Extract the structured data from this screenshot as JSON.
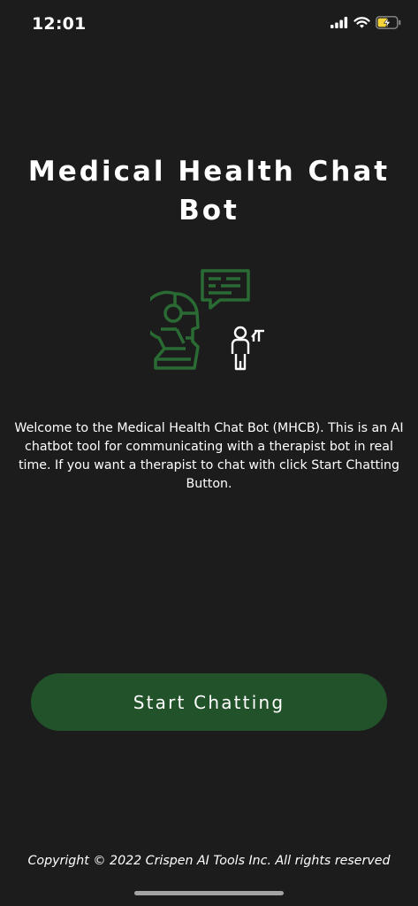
{
  "status_bar": {
    "time": "12:01",
    "icons": [
      "signal-icon",
      "wifi-icon",
      "battery-charging-icon"
    ]
  },
  "main": {
    "title": "Medical Health Chat Bot",
    "illustration": "robot-therapist-chat-illustration",
    "welcome_text": "Welcome to the Medical Health Chat Bot (MHCB). This is an AI chatbot tool for communicating with a therapist bot in real time. If you want a therapist to chat with click Start Chatting Button.",
    "start_button_label": "Start Chatting"
  },
  "footer": {
    "copyright": "Copyright © 2022 Crispen AI Tools Inc. All rights reserved"
  },
  "colors": {
    "background": "#1c1c1c",
    "accent": "#225229",
    "illustration_green": "#2a6b34",
    "battery_yellow": "#f3d53a"
  }
}
